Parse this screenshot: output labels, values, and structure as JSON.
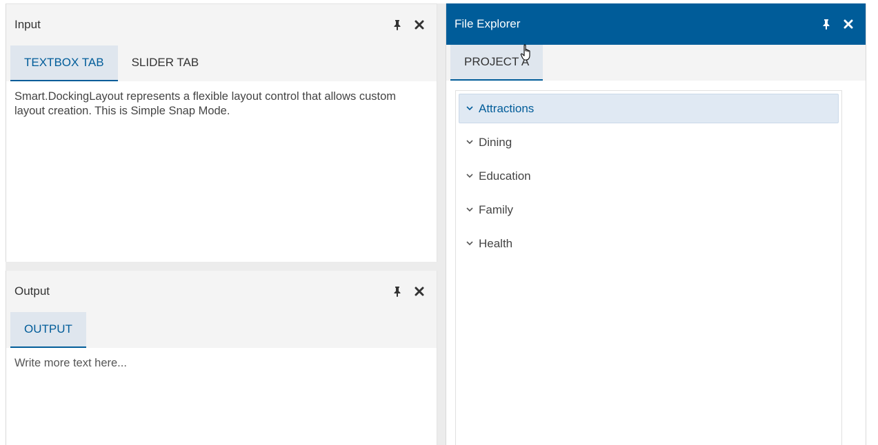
{
  "input_panel": {
    "title": "Input",
    "tabs": [
      {
        "label": "TEXTBOX TAB",
        "active": true
      },
      {
        "label": "SLIDER TAB",
        "active": false
      }
    ],
    "content": "Smart.DockingLayout represents a flexible layout control that allows custom layout creation. This is Simple Snap Mode."
  },
  "output_panel": {
    "title": "Output",
    "tabs": [
      {
        "label": "OUTPUT",
        "active": true
      }
    ],
    "placeholder": "Write more text here..."
  },
  "explorer_panel": {
    "title": "File Explorer",
    "tabs": [
      {
        "label": "PROJECT A",
        "active": true
      }
    ],
    "tree_items": [
      {
        "label": "Attractions",
        "selected": true
      },
      {
        "label": "Dining",
        "selected": false
      },
      {
        "label": "Education",
        "selected": false
      },
      {
        "label": "Family",
        "selected": false
      },
      {
        "label": "Health",
        "selected": false
      }
    ]
  },
  "icons": {
    "pin": "pin-icon",
    "close": "close-icon",
    "chevron": "chevron-down-icon",
    "cursor": "hand-pointer-cursor-icon"
  },
  "colors": {
    "accent": "#005c99",
    "header_bg": "#f4f4f4",
    "tab_active_bg": "#dfe6ee",
    "tree_selected_bg": "#e0e9f3"
  }
}
